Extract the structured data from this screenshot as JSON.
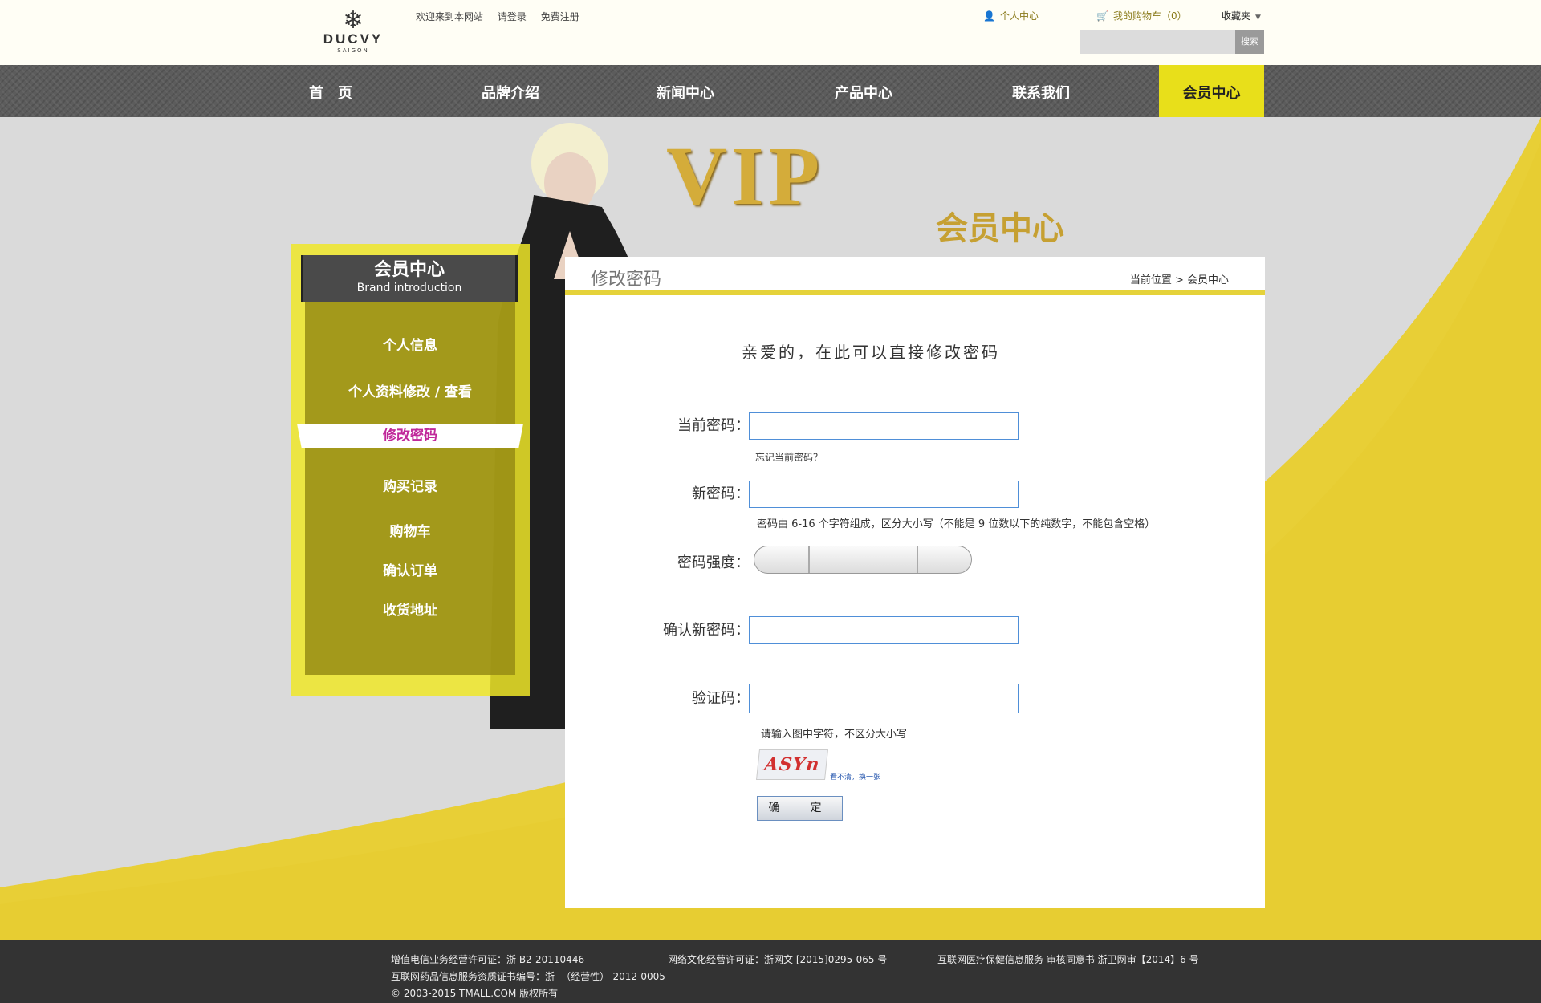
{
  "topbar": {
    "logo_brand": "DUCVY",
    "logo_sub": "SAIGON",
    "welcome": "欢迎来到本网站",
    "login": "请登录",
    "register": "免费注册",
    "user_center": "个人中心",
    "cart": "我的购物车（0）",
    "favorites": "收藏夹",
    "search_button": "搜索",
    "search_placeholder": ""
  },
  "nav": {
    "items": [
      {
        "label": "首　页"
      },
      {
        "label": "品牌介绍"
      },
      {
        "label": "新闻中心"
      },
      {
        "label": "产品中心"
      },
      {
        "label": "联系我们"
      },
      {
        "label": "会员中心",
        "active": true
      }
    ]
  },
  "banner": {
    "vip_logo": "VIP",
    "title": "会员中心"
  },
  "sidebar": {
    "title": "会员中心",
    "subtitle": "Brand introduction",
    "items": [
      {
        "label": "个人信息"
      },
      {
        "label": "个人资料修改 / 查看"
      },
      {
        "label": "修改密码",
        "active": true
      },
      {
        "label": "购买记录"
      },
      {
        "label": "购物车"
      },
      {
        "label": "确认订单"
      },
      {
        "label": "收货地址"
      }
    ]
  },
  "content": {
    "title": "修改密码",
    "breadcrumb": "当前位置 > 会员中心",
    "greeting": "亲爱的，在此可以直接修改密码",
    "form": {
      "current_label": "当前密码：",
      "current_value": "",
      "forgot": "忘记当前密码？",
      "new_label": "新密码：",
      "new_value": "",
      "new_hint": "密码由 6-16 个字符组成，区分大小写（不能是 9 位数以下的纯数字，不能包含空格）",
      "strength_label": "密码强度：",
      "confirm_label": "确认新密码：",
      "confirm_value": "",
      "captcha_label": "验证码：",
      "captcha_value": "",
      "captcha_hint": "请输入图中字符，不区分大小写",
      "captcha_text": "ASYn",
      "captcha_refresh": "看不清，换一张",
      "submit": "确　定"
    }
  },
  "footer": {
    "line1_a": "增值电信业务经营许可证：浙 B2-20110446",
    "line1_b": "网络文化经营许可证：浙网文 [2015]0295-065 号",
    "line1_c": "互联网医疗保健信息服务 审核同意书 浙卫网审【2014】6 号",
    "line2": "互联网药品信息服务资质证书编号：浙 -（经营性）-2012-0005",
    "line3": "© 2003-2015 TMALL.COM 版权所有"
  },
  "colors": {
    "accent_yellow": "#e8df1a",
    "nav_gray": "#5c5c5c",
    "active_menu_text": "#c0289a",
    "input_border": "#4f8fd8",
    "footer_bg": "#333333"
  }
}
